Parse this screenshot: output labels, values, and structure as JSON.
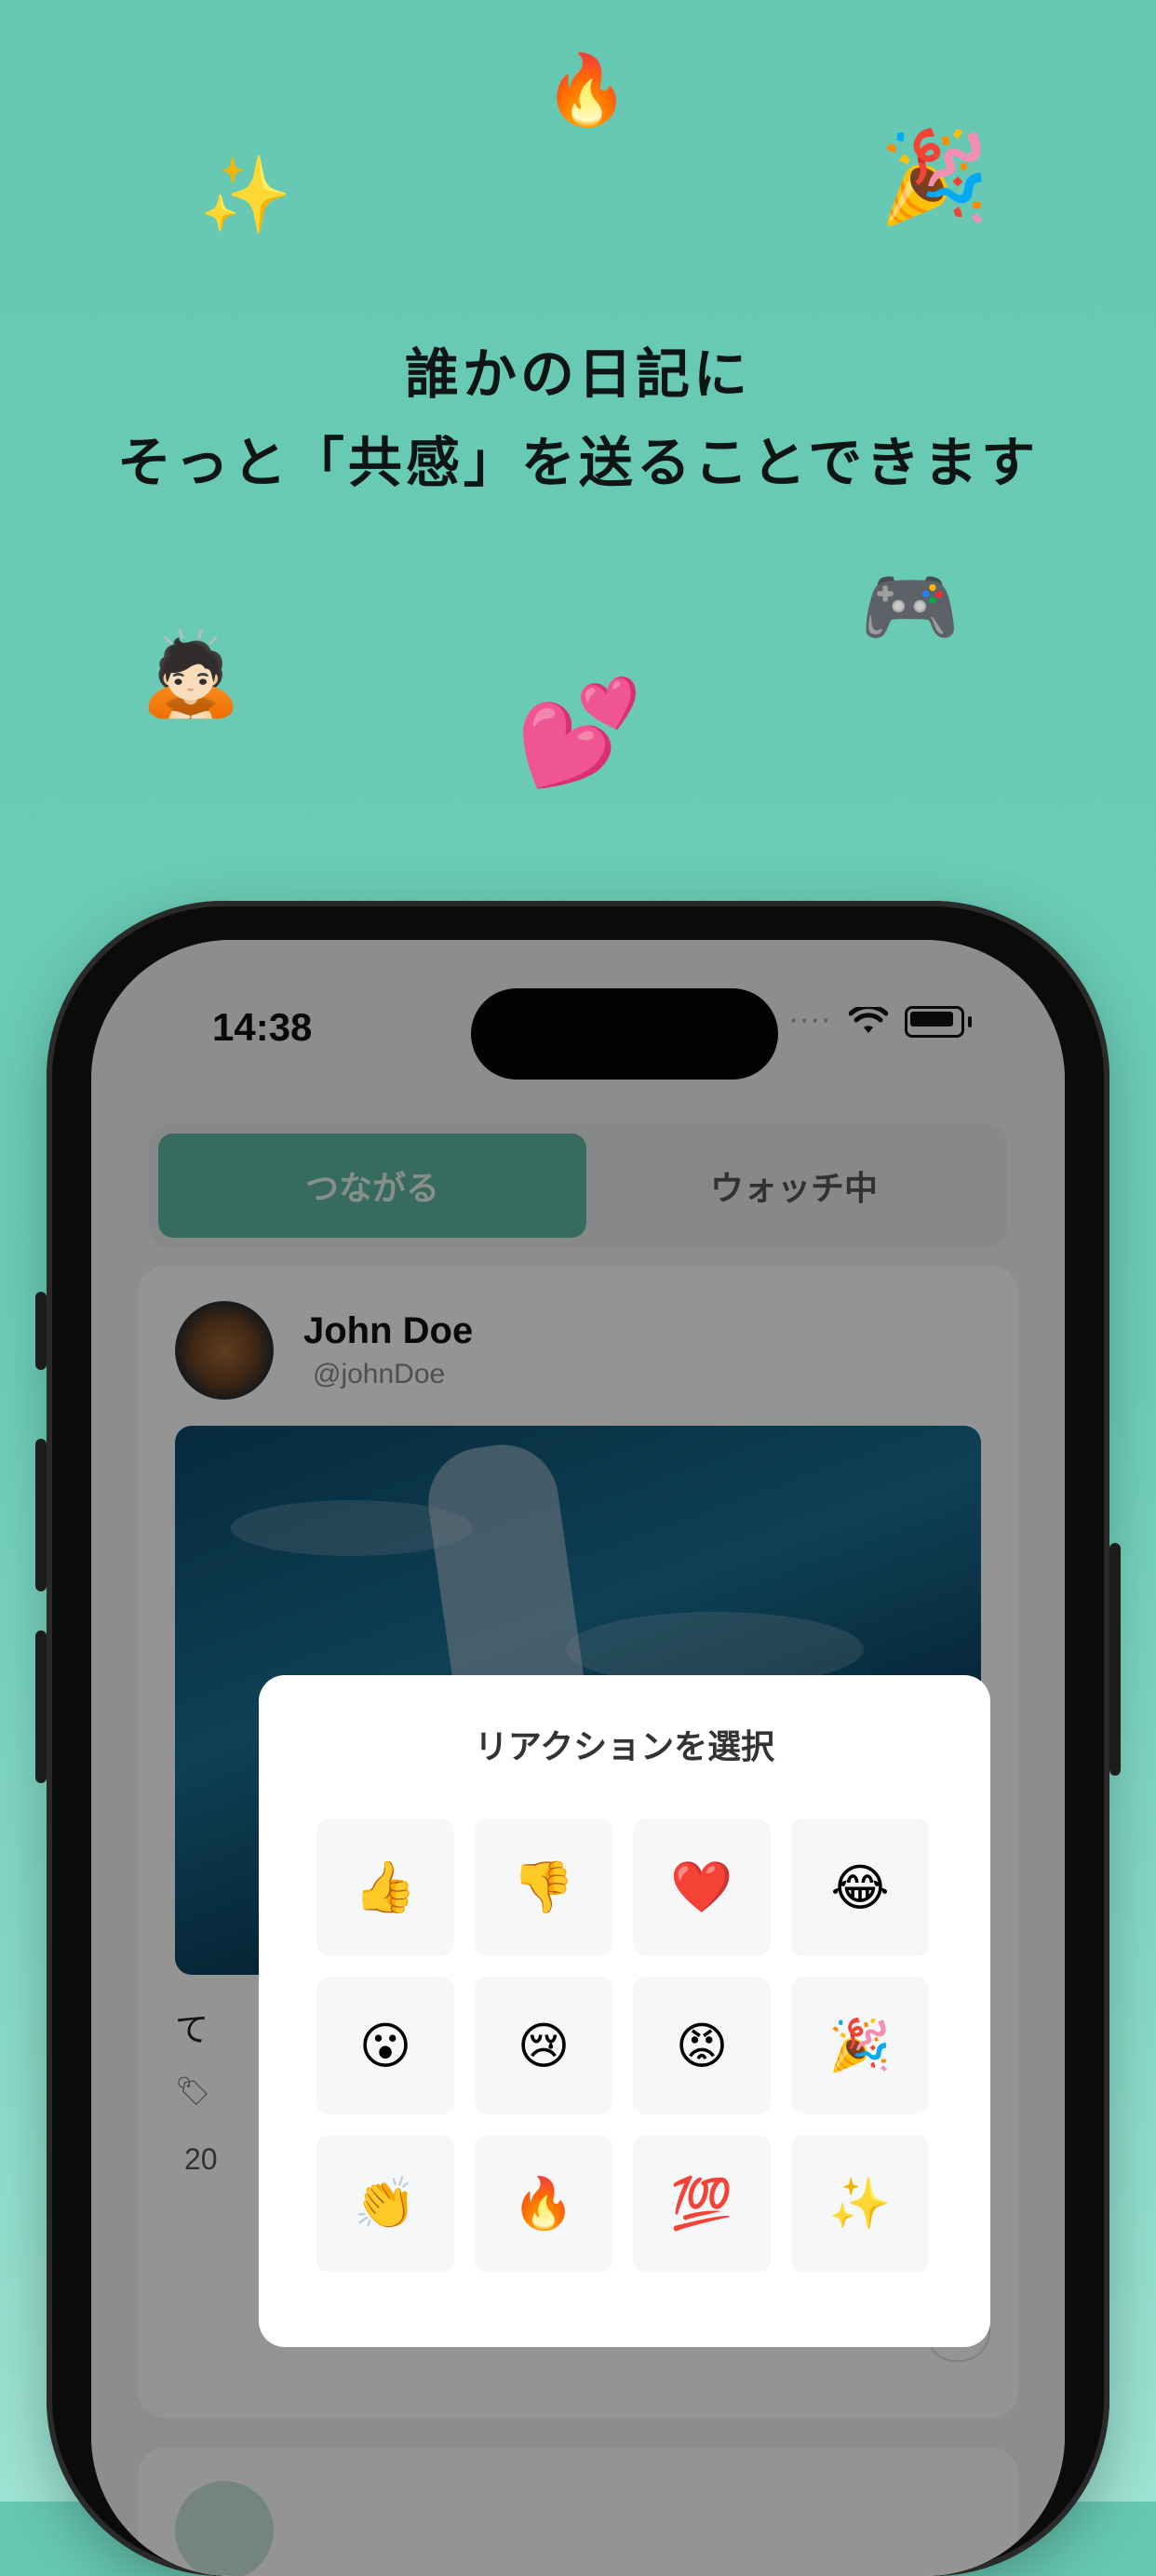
{
  "headline": {
    "line1": "誰かの日記に",
    "line2": "そっと「共感」を送ることできます"
  },
  "decorations": [
    "🔥",
    "✨",
    "🎉",
    "🎮",
    "🙇🏻",
    "💕"
  ],
  "status_bar": {
    "time": "14:38"
  },
  "segmented_control": {
    "tab_connect": "つながる",
    "tab_watching": "ウォッチ中"
  },
  "post": {
    "username": "John Doe",
    "handle": "@johnDoe",
    "text_fragment": "て",
    "date_fragment": "20"
  },
  "reaction_modal": {
    "title": "リアクションを選択",
    "emojis": [
      "👍",
      "👎",
      "❤️",
      "😂",
      "😮",
      "😢",
      "😡",
      "🎉",
      "👏",
      "🔥",
      "💯",
      "✨"
    ]
  },
  "colors": {
    "background": "#66c8b2",
    "accent": "#5db9a2"
  }
}
